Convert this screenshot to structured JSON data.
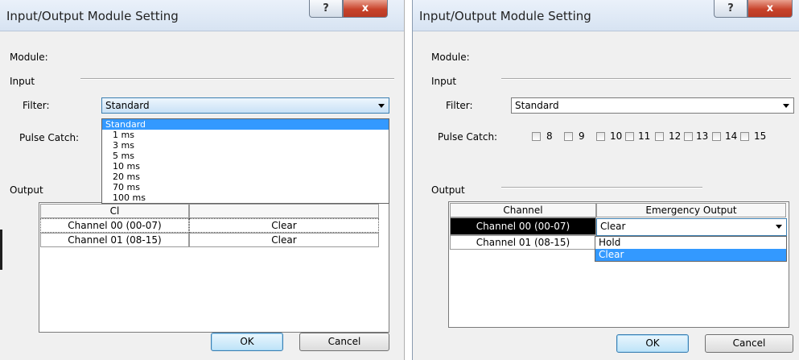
{
  "left_dialog": {
    "title": "Input/Output Module Setting",
    "help_label": "?",
    "close_label": "x",
    "module_label": "Module:",
    "input_section": "Input",
    "filter_label": "Filter:",
    "filter_value": "Standard",
    "filter_options": [
      "Standard",
      "1 ms",
      "3 ms",
      "5 ms",
      "10 ms",
      "20 ms",
      "70 ms",
      "100 ms"
    ],
    "filter_selected": "Standard",
    "pulse_catch_label": "Pulse Catch:",
    "output_section": "Output",
    "channel_header_partial": "Cl",
    "rows": [
      {
        "channel": "Channel 00 (00-07)",
        "output": "Clear"
      },
      {
        "channel": "Channel 01 (08-15)",
        "output": "Clear"
      }
    ],
    "ok_label": "OK",
    "cancel_label": "Cancel"
  },
  "right_dialog": {
    "title": "Input/Output Module Setting",
    "help_label": "?",
    "close_label": "x",
    "module_label": "Module:",
    "input_section": "Input",
    "filter_label": "Filter:",
    "filter_value": "Standard",
    "pulse_catch_label": "Pulse Catch:",
    "pulse_bits": [
      "8",
      "9",
      "10",
      "11",
      "12",
      "13",
      "14",
      "15"
    ],
    "output_section": "Output",
    "headers": {
      "channel": "Channel",
      "emergency": "Emergency Output"
    },
    "rows": [
      {
        "channel": "Channel 00 (00-07)",
        "output": "Clear"
      },
      {
        "channel": "Channel 01 (08-15)",
        "output": ""
      }
    ],
    "emergency_options": [
      "Hold",
      "Clear"
    ],
    "emergency_selected": "Clear",
    "ok_label": "OK",
    "cancel_label": "Cancel"
  },
  "colors": {
    "selection": "#3399ff",
    "dialog_bg": "#f0f0f0",
    "close_button": "#c8432b"
  }
}
